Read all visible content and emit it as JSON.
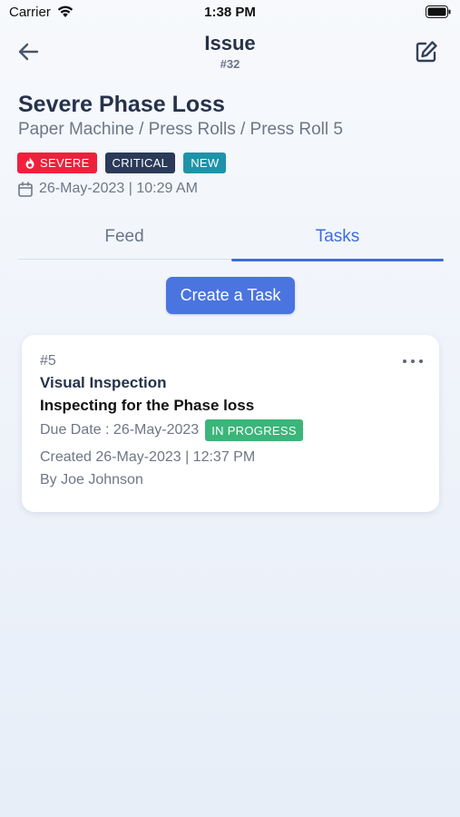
{
  "status_bar": {
    "carrier": "Carrier",
    "time": "1:38 PM"
  },
  "header": {
    "title": "Issue",
    "subtitle": "#32",
    "back_icon": "back-arrow-icon",
    "edit_icon": "edit-icon"
  },
  "issue": {
    "title": "Severe Phase Loss",
    "path": "Paper Machine / Press Rolls / Press Roll 5",
    "badges": [
      {
        "label": "SEVERE",
        "color": "#f0203d",
        "icon": "flame-icon"
      },
      {
        "label": "CRITICAL",
        "color": "#2a3a58"
      },
      {
        "label": "NEW",
        "color": "#1f93a8"
      }
    ],
    "date": "26-May-2023 | 10:29 AM"
  },
  "tabs": [
    {
      "label": "Feed",
      "active": false
    },
    {
      "label": "Tasks",
      "active": true
    }
  ],
  "accent_color": "#3e6dd8",
  "create_button": {
    "label": "Create a Task"
  },
  "task": {
    "number": "#5",
    "title": "Visual Inspection",
    "description": "Inspecting for the Phase loss",
    "due": "Due Date : 26-May-2023",
    "status": "IN PROGRESS",
    "status_color": "#3bb57a",
    "created": "Created 26-May-2023 | 12:37 PM",
    "by": "By Joe Johnson"
  }
}
